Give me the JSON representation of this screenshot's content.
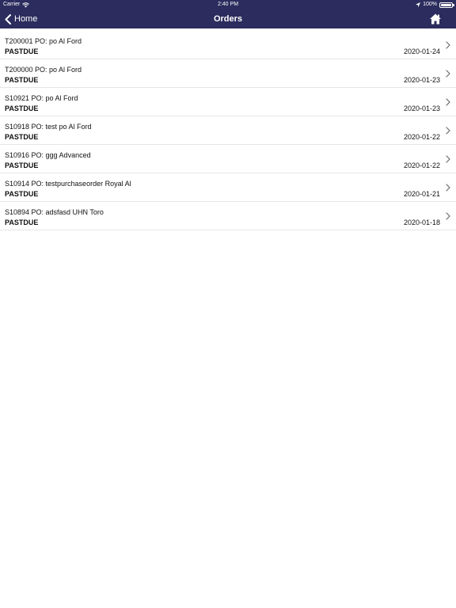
{
  "status_bar": {
    "carrier": "Carrier",
    "time": "2:40 PM",
    "battery": "100%",
    "battery_level": 1.0
  },
  "nav": {
    "back_label": "Home",
    "title": "Orders",
    "home_icon": "home-icon"
  },
  "orders": [
    {
      "title": "T200001 PO: po Al Ford",
      "status": "PASTDUE",
      "date": "2020-01-24"
    },
    {
      "title": "T200000 PO: po Al Ford",
      "status": "PASTDUE",
      "date": "2020-01-23"
    },
    {
      "title": "S10921 PO: po Al Ford",
      "status": "PASTDUE",
      "date": "2020-01-23"
    },
    {
      "title": "S10918 PO: test po Al Ford",
      "status": "PASTDUE",
      "date": "2020-01-22"
    },
    {
      "title": "S10916 PO: ggg Advanced",
      "status": "PASTDUE",
      "date": "2020-01-22"
    },
    {
      "title": "S10914 PO: testpurchaseorder Royal Al",
      "status": "PASTDUE",
      "date": "2020-01-21"
    },
    {
      "title": "S10894 PO: adsfasd UHN Toro",
      "status": "PASTDUE",
      "date": "2020-01-18"
    }
  ],
  "colors": {
    "nav_background": "#2c2c5e",
    "nav_text": "#ffffff",
    "divider": "#e6e6e6"
  }
}
